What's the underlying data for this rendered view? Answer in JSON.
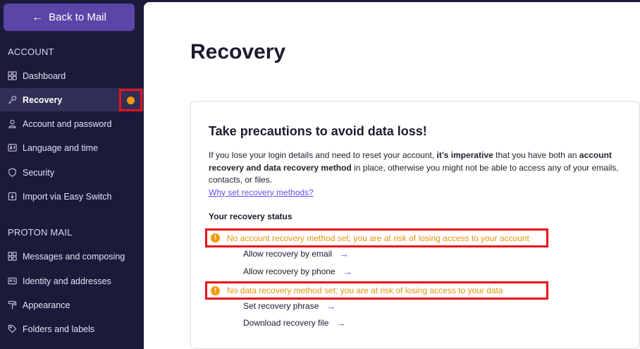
{
  "sidebar": {
    "back_label": "Back to Mail",
    "account_title": "ACCOUNT",
    "account_items": [
      {
        "label": "Dashboard",
        "icon": "dashboard-icon"
      },
      {
        "label": "Recovery",
        "icon": "key-icon",
        "active": true
      },
      {
        "label": "Account and password",
        "icon": "user-icon"
      },
      {
        "label": "Language and time",
        "icon": "language-icon"
      },
      {
        "label": "Security",
        "icon": "shield-icon"
      },
      {
        "label": "Import via Easy Switch",
        "icon": "import-icon"
      }
    ],
    "mail_title": "PROTON MAIL",
    "mail_items": [
      {
        "label": "Messages and composing",
        "icon": "grid-icon"
      },
      {
        "label": "Identity and addresses",
        "icon": "id-card-icon"
      },
      {
        "label": "Appearance",
        "icon": "paint-roller-icon"
      },
      {
        "label": "Folders and labels",
        "icon": "tag-icon"
      }
    ]
  },
  "main": {
    "title": "Recovery",
    "card": {
      "title": "Take precautions to avoid data loss!",
      "text_1": "If you lose your login details and need to reset your account, ",
      "text_bold_1": "it’s imperative",
      "text_2": " that you have both an ",
      "text_bold_2": "account recovery and data recovery method",
      "text_3": " in place, otherwise you might not be able to access any of your emails, contacts, or files.",
      "link": "Why set recovery methods?",
      "status_heading": "Your recovery status",
      "warning_account": "No account recovery method set; you are at risk of losing access to your account",
      "action_email": "Allow recovery by email",
      "action_phone": "Allow recovery by phone",
      "warning_data": "No data recovery method set; you are at risk of losing access to your data",
      "action_phrase": "Set recovery phrase",
      "action_file": "Download recovery file"
    }
  },
  "colors": {
    "sidebar_bg": "#1c1a3a",
    "accent": "#6d4aff",
    "warning": "#e8920c",
    "notification_dot": "#f59a0c"
  }
}
